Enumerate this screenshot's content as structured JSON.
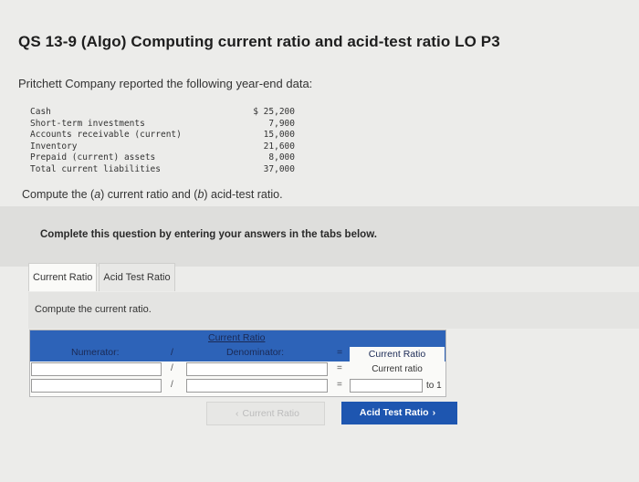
{
  "header": {
    "title": "QS 13-9 (Algo) Computing current ratio and acid-test ratio LO P3"
  },
  "intro": "Pritchett Company reported the following year-end data:",
  "financial_data": [
    {
      "label": "Cash",
      "value": "$ 25,200"
    },
    {
      "label": "Short-term investments",
      "value": "7,900"
    },
    {
      "label": "Accounts receivable (current)",
      "value": "15,000"
    },
    {
      "label": "Inventory",
      "value": "21,600"
    },
    {
      "label": "Prepaid (current) assets",
      "value": "8,000"
    },
    {
      "label": "Total current liabilities",
      "value": "37,000"
    }
  ],
  "prompt": "Compute the (a) current ratio and (b) acid-test ratio.",
  "banner": "Complete this question by entering your answers in the tabs below.",
  "tabs": [
    {
      "label": "Current Ratio",
      "active": true
    },
    {
      "label": "Acid Test Ratio",
      "active": false
    }
  ],
  "panel_instruction": "Compute the current ratio.",
  "calc_table": {
    "title": "Current Ratio",
    "numerator_label": "Numerator:",
    "slash": "/",
    "denominator_label": "Denominator:",
    "equals": "=",
    "ratio_label": "Current Ratio",
    "row1": {
      "numerator": "",
      "denominator": "",
      "result": "Current ratio"
    },
    "row2": {
      "numerator": "",
      "denominator": "",
      "result": "",
      "suffix": "to 1"
    }
  },
  "nav": {
    "prev_label": "Current Ratio",
    "prev_icon": "chevron-left-icon",
    "next_label": "Acid Test Ratio",
    "next_icon": "chevron-right-icon"
  },
  "colors": {
    "header_blue": "#2d63b8",
    "next_button": "#1e56b0",
    "background": "#ececea"
  }
}
